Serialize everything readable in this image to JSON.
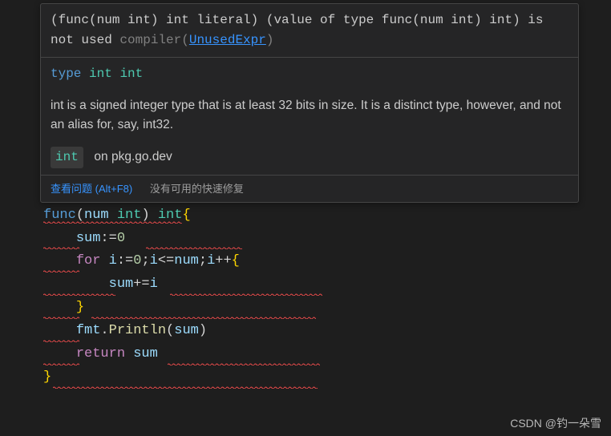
{
  "tooltip": {
    "diagnostic": {
      "prefix": "(func(num int) int literal) (value of type func(num int) int) is not used ",
      "compiler_label": "compiler",
      "rule_link": "UnusedExpr"
    },
    "signature": {
      "keyword": "type",
      "name": "int",
      "base": "int"
    },
    "doc": "int is a signed integer type that is at least 32 bits in size. It is a distinct type, however, and not an alias for, say, int32.",
    "pkg_link": {
      "badge": "int",
      "text": "on pkg.go.dev"
    },
    "footer": {
      "view_problem": "查看问题 (Alt+F8)",
      "no_quickfix": "没有可用的快速修复"
    }
  },
  "code": {
    "l1": {
      "func": "func",
      "param": "num",
      "type1": "int",
      "type2": "int"
    },
    "l2": {
      "var": "sum",
      "op": ":=",
      "val": "0"
    },
    "l3": {
      "kw": "for",
      "var": "i",
      "op1": ":=",
      "v0": "0",
      "cond_var": "i",
      "cond_op": "<=",
      "cond_rhs": "num",
      "inc": "i++"
    },
    "l4": {
      "lhs": "sum",
      "op": "+=",
      "rhs": "i"
    },
    "l6": {
      "pkg": "fmt",
      "call": "Println",
      "arg": "sum"
    },
    "l7": {
      "kw": "return",
      "var": "sum"
    }
  },
  "watermark": "CSDN @钓一朵雪"
}
